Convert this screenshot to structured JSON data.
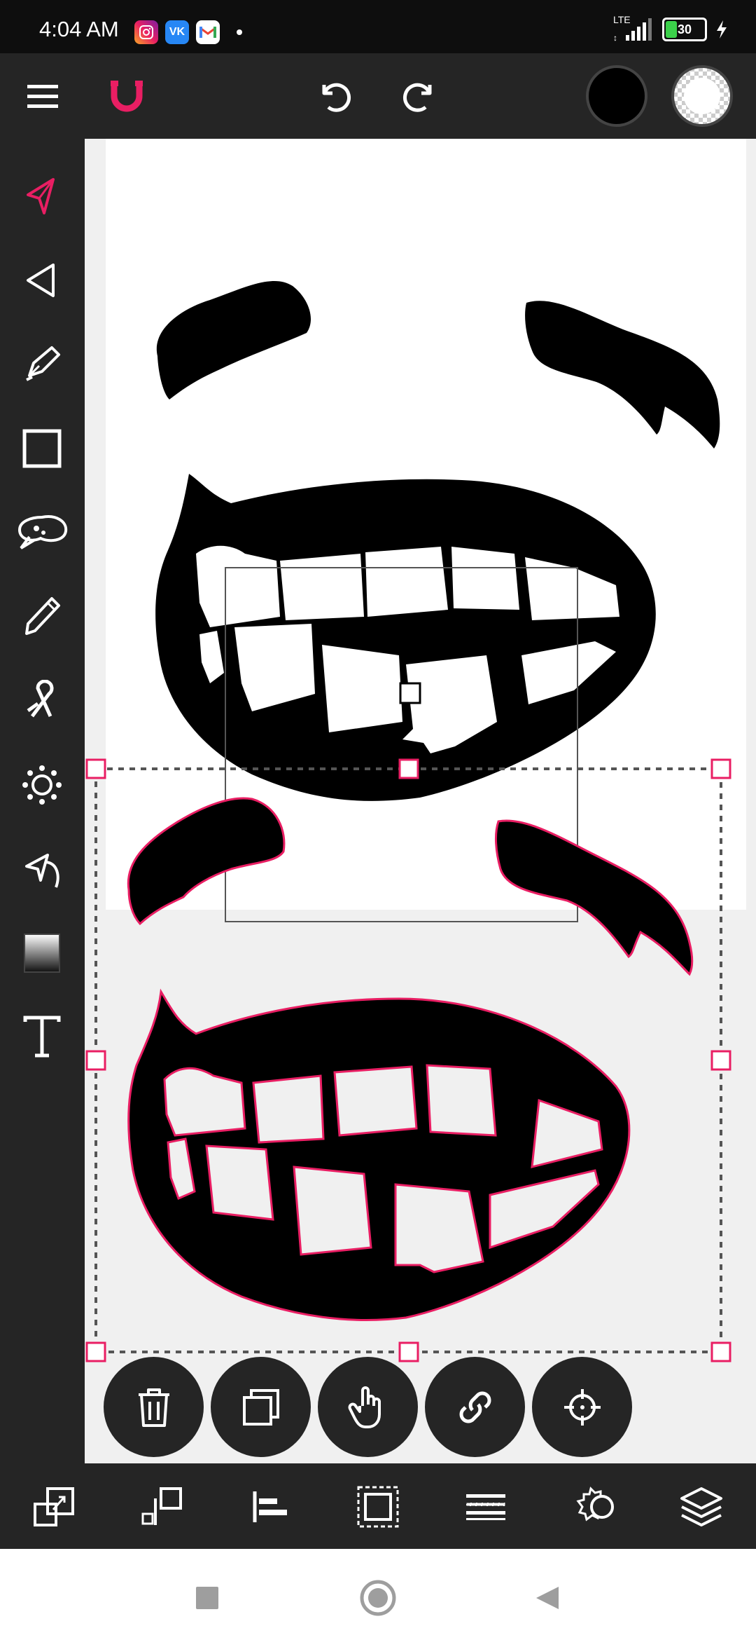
{
  "status": {
    "time": "4:04 AM",
    "network": "LTE",
    "battery": "30",
    "apps": [
      "instagram-icon",
      "vk-icon",
      "gmail-icon"
    ]
  },
  "toolbar": {
    "icons": [
      "menu-icon",
      "magnet-icon",
      "undo-icon",
      "redo-icon",
      "stroke-color",
      "fill-color"
    ],
    "stroke_color": "#000000",
    "accent": "#e91e63"
  },
  "sidebar": {
    "tools": [
      "select-tool",
      "direct-select-tool",
      "pen-tool",
      "rectangle-tool",
      "shape-builder-tool",
      "pencil-tool",
      "ribbon-tool",
      "sun-brush-tool",
      "path-arrow-tool",
      "gradient-tool",
      "text-tool"
    ],
    "active": "select-tool"
  },
  "actions": {
    "icons": [
      "delete-icon",
      "duplicate-icon",
      "pan-hand-icon",
      "link-icon",
      "target-icon"
    ]
  },
  "bottombar": {
    "icons": [
      "transform-icon",
      "arrange-icon",
      "align-icon",
      "group-icon",
      "distribute-icon",
      "effects-icon",
      "layers-icon"
    ]
  },
  "navbar": {
    "icons": [
      "recents-button",
      "home-button",
      "back-button"
    ]
  }
}
